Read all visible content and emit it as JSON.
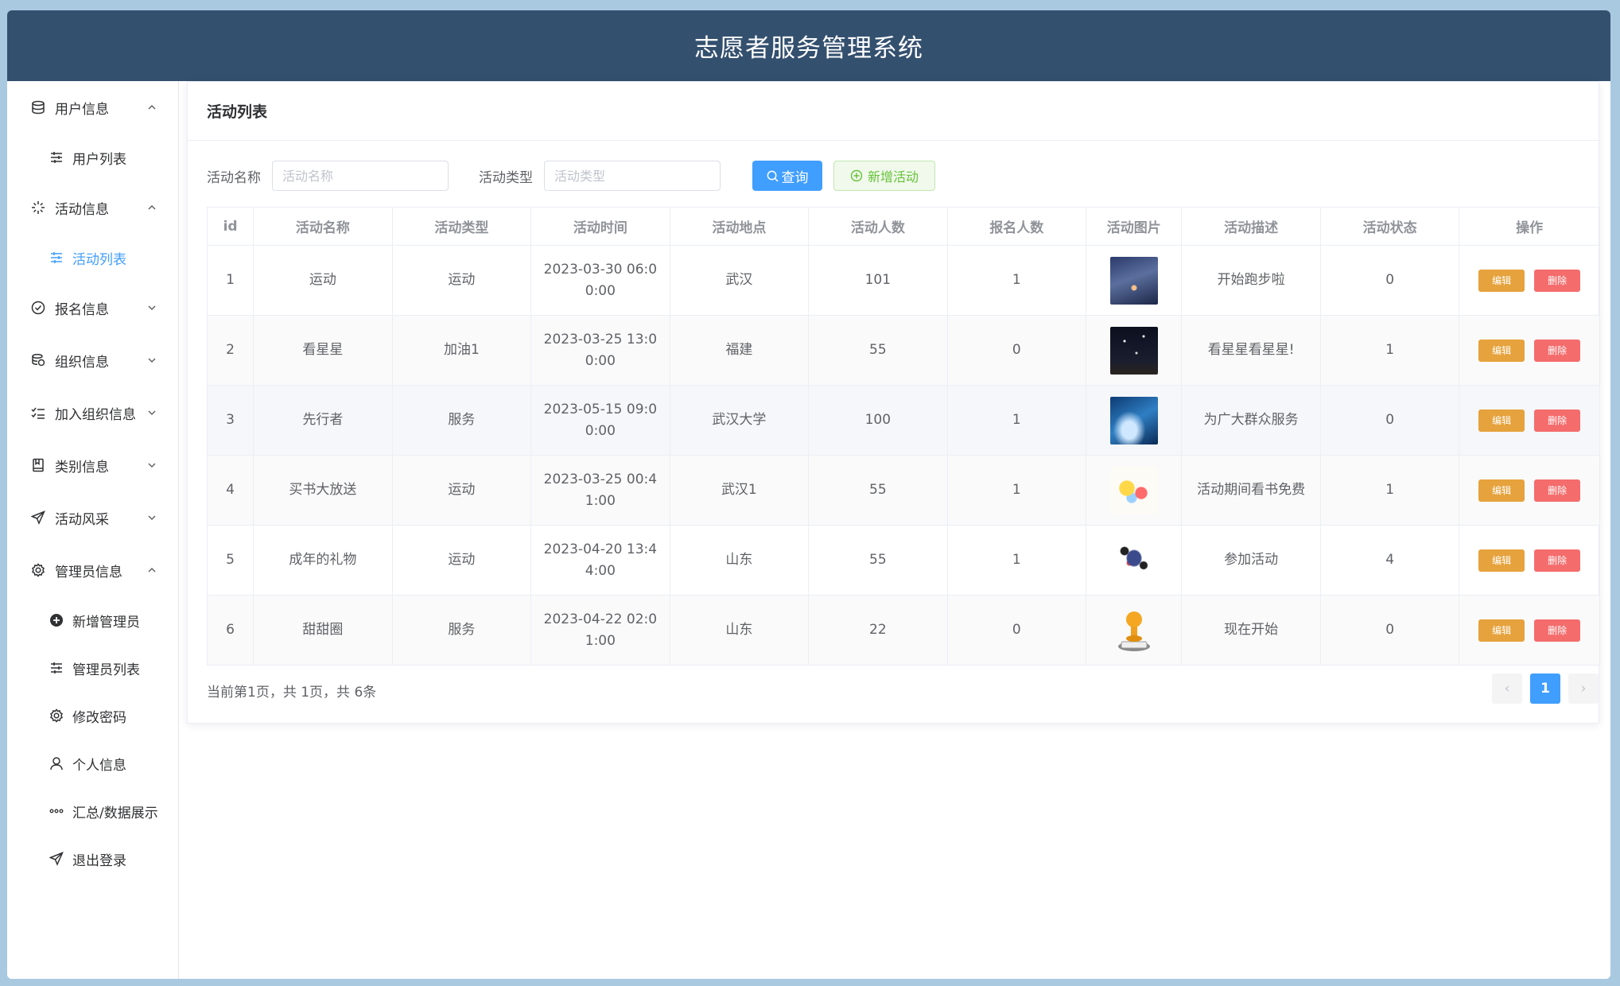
{
  "app": {
    "title": "志愿者服务管理系统"
  },
  "sidebar": {
    "groups": [
      {
        "label": "用户信息",
        "icon": "database-icon",
        "expanded": true,
        "items": [
          {
            "label": "用户列表",
            "icon": "sliders-icon"
          }
        ]
      },
      {
        "label": "活动信息",
        "icon": "sparkle-icon",
        "expanded": true,
        "items": [
          {
            "label": "活动列表",
            "icon": "sliders-icon",
            "active": true
          }
        ]
      },
      {
        "label": "报名信息",
        "icon": "check-circle-icon",
        "expanded": false
      },
      {
        "label": "组织信息",
        "icon": "coins-icon",
        "expanded": false
      },
      {
        "label": "加入组织信息",
        "icon": "checklist-icon",
        "expanded": false
      },
      {
        "label": "类别信息",
        "icon": "notebook-icon",
        "expanded": false
      },
      {
        "label": "活动风采",
        "icon": "send-icon",
        "expanded": false
      },
      {
        "label": "管理员信息",
        "icon": "gear-icon",
        "expanded": true,
        "items": [
          {
            "label": "新增管理员",
            "icon": "plus-circle-icon"
          },
          {
            "label": "管理员列表",
            "icon": "sliders-icon"
          },
          {
            "label": "修改密码",
            "icon": "gear-icon"
          },
          {
            "label": "个人信息",
            "icon": "user-icon"
          },
          {
            "label": "汇总/数据展示",
            "icon": "dots-icon"
          },
          {
            "label": "退出登录",
            "icon": "send-icon"
          }
        ]
      }
    ]
  },
  "page": {
    "title": "活动列表",
    "search": {
      "name_label": "活动名称",
      "name_placeholder": "活动名称",
      "type_label": "活动类型",
      "type_placeholder": "活动类型",
      "query_label": "查询",
      "add_label": "新增活动"
    },
    "table": {
      "headers": [
        "id",
        "活动名称",
        "活动类型",
        "活动时间",
        "活动地点",
        "活动人数",
        "报名人数",
        "活动图片",
        "活动描述",
        "活动状态",
        "操作"
      ],
      "rows": [
        {
          "id": "1",
          "name": "运动",
          "type": "运动",
          "time_a": "2023-03-30 06:0",
          "time_b": "0:00",
          "place": "武汉",
          "people": "101",
          "signed": "1",
          "image": "night-city-art",
          "desc": "开始跑步啦",
          "status": "0"
        },
        {
          "id": "2",
          "name": "看星星",
          "type": "加油1",
          "time_a": "2023-03-25 13:0",
          "time_b": "0:00",
          "place": "福建",
          "people": "55",
          "signed": "0",
          "image": "starry-sky",
          "desc": "看星星看星星!",
          "status": "1"
        },
        {
          "id": "3",
          "name": "先行者",
          "type": "服务",
          "time_a": "2023-05-15 09:0",
          "time_b": "0:00",
          "place": "武汉大学",
          "people": "100",
          "signed": "1",
          "image": "blue-galaxy",
          "desc": "为广大群众服务",
          "status": "0"
        },
        {
          "id": "4",
          "name": "买书大放送",
          "type": "运动",
          "time_a": "2023-03-25 00:4",
          "time_b": "1:00",
          "place": "武汉1",
          "people": "55",
          "signed": "1",
          "image": "colorful-illustration",
          "desc": "活动期间看书免费",
          "status": "1"
        },
        {
          "id": "5",
          "name": "成年的礼物",
          "type": "运动",
          "time_a": "2023-04-20 13:4",
          "time_b": "4:00",
          "place": "山东",
          "people": "55",
          "signed": "1",
          "image": "running-figures",
          "desc": "参加活动",
          "status": "4"
        },
        {
          "id": "6",
          "name": "甜甜圈",
          "type": "服务",
          "time_a": "2023-04-22 02:0",
          "time_b": "1:00",
          "place": "山东",
          "people": "22",
          "signed": "0",
          "image": "stamp",
          "desc": "现在开始",
          "status": "0"
        }
      ],
      "edit_label": "编辑",
      "delete_label": "删除"
    },
    "pagination": {
      "info": "当前第1页，共 1页，共 6条",
      "current": "1",
      "prev": "‹",
      "next": "›"
    }
  },
  "colors": {
    "header": "#34506f",
    "primary": "#409eff",
    "warning": "#e6a23c",
    "danger": "#f56c6c",
    "success": "#67c23a"
  }
}
